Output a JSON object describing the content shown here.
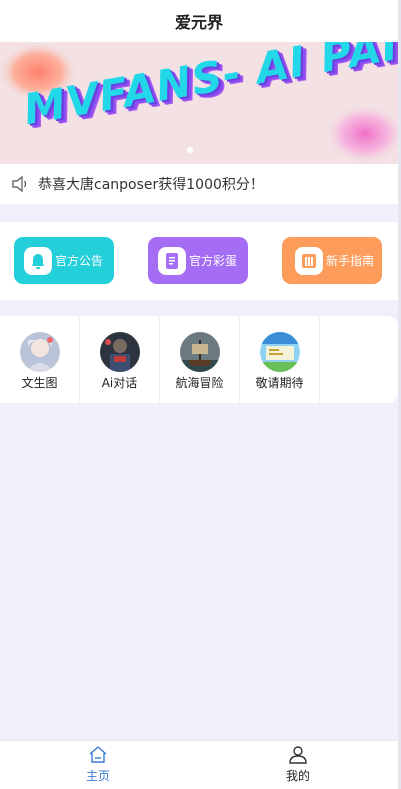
{
  "header": {
    "title": "爱元界"
  },
  "banner": {
    "text": "MVFANS- AI PAINTING"
  },
  "notice": {
    "text": "恭喜大唐canposer获得1000积分！"
  },
  "quick_buttons": [
    {
      "label": "官方公告",
      "icon": "bell-icon",
      "color": "#23d0da"
    },
    {
      "label": "官方彩蛋",
      "icon": "document-icon",
      "color": "#a56cf4"
    },
    {
      "label": "新手指南",
      "icon": "guide-book-icon",
      "color": "#fd9c5b"
    }
  ],
  "features": [
    {
      "label": "文生图",
      "icon": "anime-girl-avatar"
    },
    {
      "label": "Ai对话",
      "icon": "robot-avatar"
    },
    {
      "label": "航海冒险",
      "icon": "pirate-ship-avatar"
    },
    {
      "label": "敬请期待",
      "icon": "coming-soon-avatar"
    }
  ],
  "tabbar": {
    "home_label": "主页",
    "mine_label": "我的",
    "active_color": "#3a7bd5"
  }
}
